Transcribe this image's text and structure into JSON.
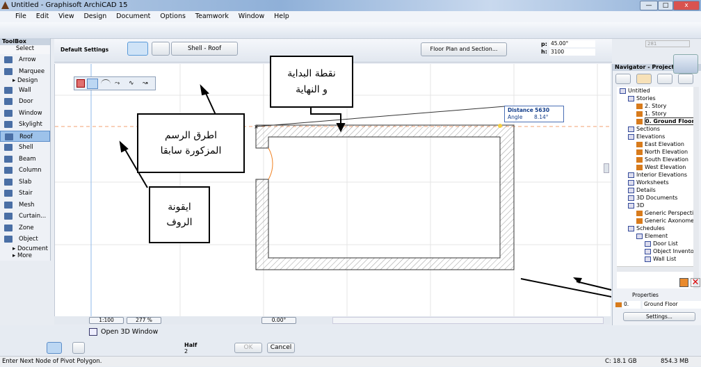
{
  "window": {
    "title": "Untitled - Graphisoft ArchiCAD 15",
    "min": "—",
    "max": "□",
    "close": "x"
  },
  "menu": [
    "File",
    "Edit",
    "View",
    "Design",
    "Document",
    "Options",
    "Teamwork",
    "Window",
    "Help"
  ],
  "toolbox": {
    "title": "ToolBox",
    "select": "Select",
    "items": [
      {
        "label": "Arrow"
      },
      {
        "label": "Marquee"
      },
      {
        "label": "Design",
        "header": true
      },
      {
        "label": "Wall"
      },
      {
        "label": "Door"
      },
      {
        "label": "Window"
      },
      {
        "label": "Skylight"
      },
      {
        "label": "Roof",
        "selected": true
      },
      {
        "label": "Shell"
      },
      {
        "label": "Beam"
      },
      {
        "label": "Column"
      },
      {
        "label": "Slab"
      },
      {
        "label": "Stair"
      },
      {
        "label": "Mesh"
      },
      {
        "label": "Curtain..."
      },
      {
        "label": "Zone"
      },
      {
        "label": "Object"
      },
      {
        "label": "Document",
        "header": true
      },
      {
        "label": "More",
        "header": true
      }
    ]
  },
  "infobox": {
    "default_settings": "Default Settings",
    "layer": "Shell - Roof",
    "floor_plan_btn": "Floor Plan and Section...",
    "p_label": "p:",
    "p_value": "45.00°",
    "h_label": "h:",
    "h_value": "3100",
    "degree": "°",
    "elev": "281"
  },
  "tooltip": {
    "distance_label": "Distance",
    "distance": "5630",
    "angle_label": "Angle",
    "angle": "8.14°"
  },
  "callouts": {
    "start_end": "نقطة البداية\nو النهاية",
    "methods": "اطرق الرسم\nالمزكورة سابقا",
    "roof_icon": "ايقونة\nالروف"
  },
  "navigator": {
    "title": "Navigator - Project",
    "tree": [
      {
        "label": "Untitled",
        "level": 0
      },
      {
        "label": "Stories",
        "level": 1
      },
      {
        "label": "2. Story",
        "level": 2,
        "o": true
      },
      {
        "label": "1. Story",
        "level": 2,
        "o": true
      },
      {
        "label": "0. Ground Floor",
        "level": 2,
        "o": true,
        "bold": true
      },
      {
        "label": "Sections",
        "level": 1
      },
      {
        "label": "Elevations",
        "level": 1
      },
      {
        "label": "East Elevation",
        "level": 2,
        "o": true
      },
      {
        "label": "North Elevation",
        "level": 2,
        "o": true
      },
      {
        "label": "South Elevation",
        "level": 2,
        "o": true
      },
      {
        "label": "West Elevation",
        "level": 2,
        "o": true
      },
      {
        "label": "Interior Elevations",
        "level": 1
      },
      {
        "label": "Worksheets",
        "level": 1
      },
      {
        "label": "Details",
        "level": 1
      },
      {
        "label": "3D Documents",
        "level": 1
      },
      {
        "label": "3D",
        "level": 1
      },
      {
        "label": "Generic Perspective",
        "level": 2,
        "o": true
      },
      {
        "label": "Generic Axonometry",
        "level": 2,
        "o": true
      },
      {
        "label": "Schedules",
        "level": 1
      },
      {
        "label": "Element",
        "level": 2
      },
      {
        "label": "Door List",
        "level": 3
      },
      {
        "label": "Object Inventory",
        "level": 3
      },
      {
        "label": "Wall List",
        "level": 3
      }
    ],
    "properties": "Properties",
    "story_num": "0.",
    "story_name": "Ground Floor",
    "settings": "Settings..."
  },
  "canvas_bar": {
    "scale": "1:100",
    "zoom": "277 %",
    "angle": "0.00°"
  },
  "toolbar2": {
    "open3d": "Open 3D Window"
  },
  "toolbar3": {
    "half": "Half",
    "half_num": "2",
    "ok": "OK",
    "cancel": "Cancel"
  },
  "status": {
    "message": "Enter Next Node of Pivot Polygon.",
    "disk": "C: 18.1 GB",
    "memory": "854.3 MB"
  }
}
